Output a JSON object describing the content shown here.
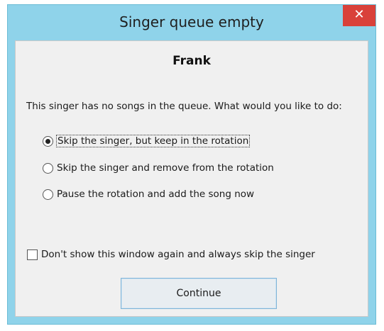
{
  "window": {
    "title": "Singer queue empty",
    "close_glyph": "✕"
  },
  "dialog": {
    "singer_name": "Frank",
    "prompt": "This singer has no songs in the queue. What would you like to do:",
    "options": [
      {
        "label": "Skip the singer, but keep in the rotation",
        "selected": true
      },
      {
        "label": "Skip the singer and remove from the rotation",
        "selected": false
      },
      {
        "label": "Pause the rotation and add the song now",
        "selected": false
      }
    ],
    "dont_show_label": "Don't show this window again and always skip the singer",
    "dont_show_checked": false,
    "continue_label": "Continue"
  },
  "colors": {
    "titlebar": "#8fd3ea",
    "close": "#d9413a",
    "client": "#f0f0f0",
    "button_border": "#7fb4d8"
  },
  "icons": {
    "close": "close-icon"
  }
}
